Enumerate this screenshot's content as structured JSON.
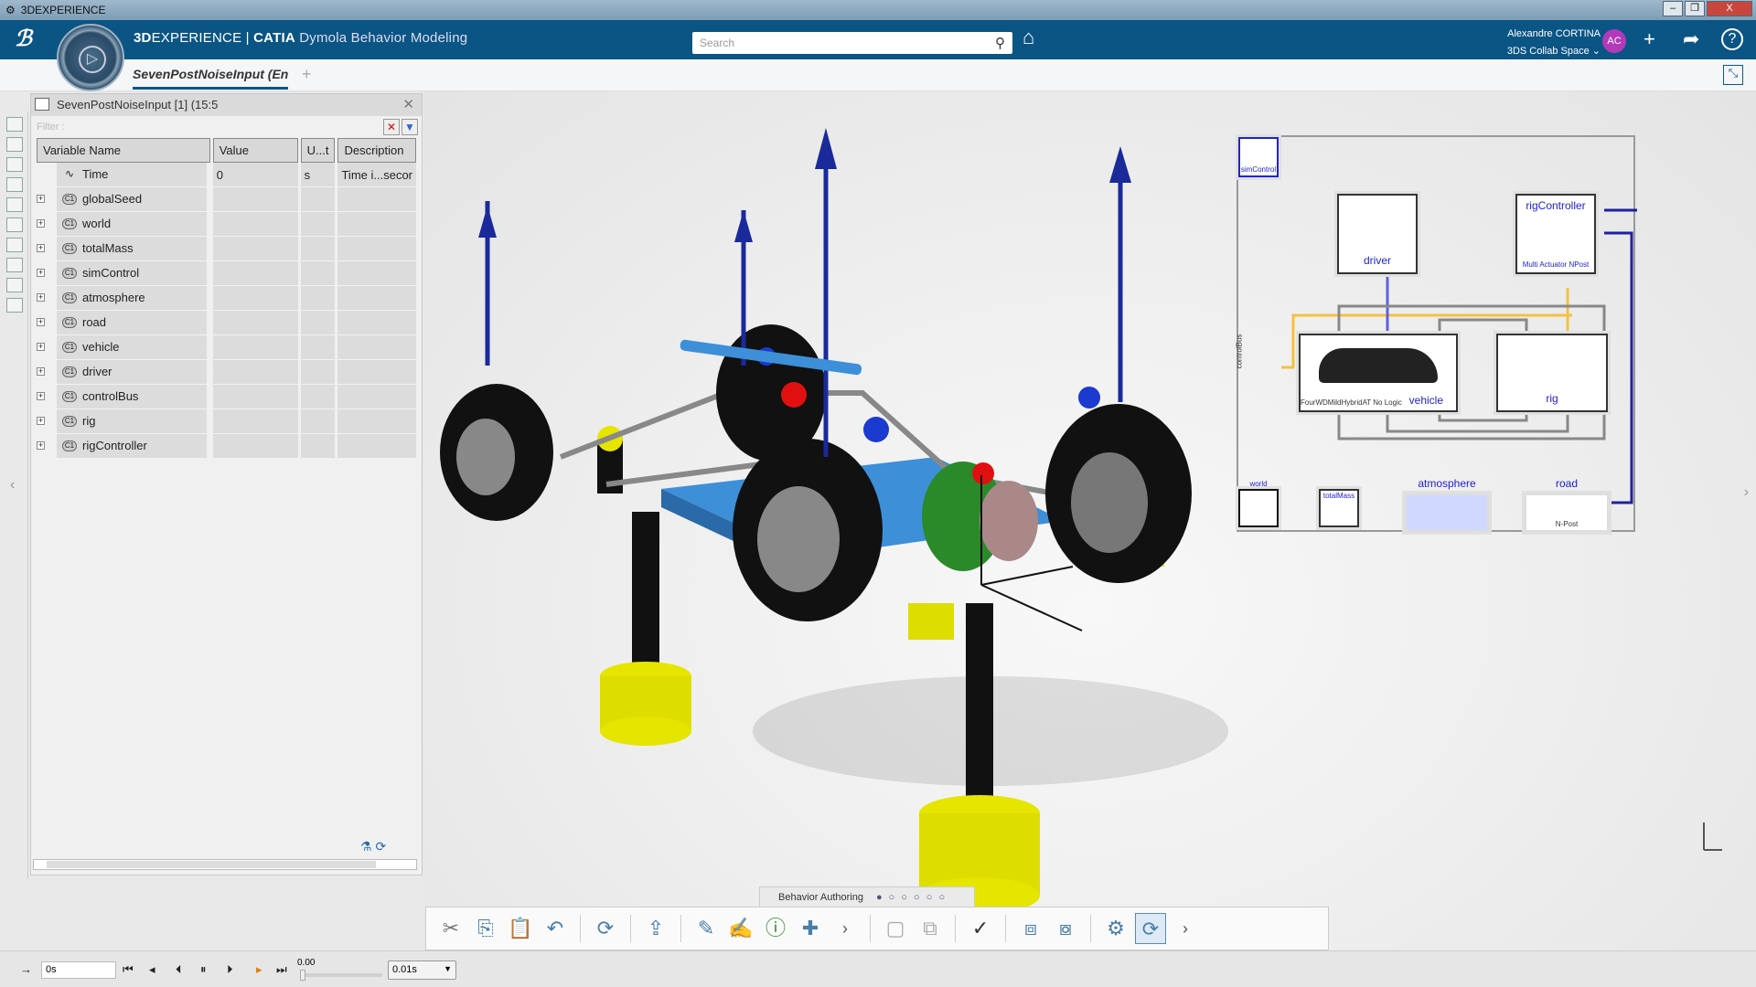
{
  "window": {
    "title": "3DEXPERIENCE",
    "minimize": "–",
    "restore": "❐",
    "close": "X"
  },
  "header": {
    "brand_3d": "3D",
    "brand_exp": "EXPERIENCE",
    "brand_sep": "|",
    "brand_catia": "CATIA",
    "app_name": "Dymola Behavior Modeling",
    "search_placeholder": "Search",
    "user_name": "Alexandre CORTINA",
    "collab_space": "3DS Collab Space",
    "avatar_initials": "AC",
    "compass_play": "▷"
  },
  "tabs": [
    {
      "label": "SevenPostNoiseInput (Encr",
      "active": true
    }
  ],
  "add_tab": "+",
  "panel": {
    "title": "SevenPostNoiseInput [1] (15:5",
    "filter_label": "Filter :",
    "columns": [
      "Variable Name",
      "Value",
      "U...t",
      "Description"
    ],
    "rows": [
      {
        "name": "Time",
        "value": "0",
        "unit": "s",
        "description": "Time i...secor"
      },
      {
        "name": "globalSeed"
      },
      {
        "name": "world"
      },
      {
        "name": "totalMass"
      },
      {
        "name": "simControl"
      },
      {
        "name": "atmosphere"
      },
      {
        "name": "road"
      },
      {
        "name": "vehicle"
      },
      {
        "name": "driver"
      },
      {
        "name": "controlBus"
      },
      {
        "name": "rig"
      },
      {
        "name": "rigController"
      }
    ]
  },
  "diagram": {
    "blocks": {
      "simControl": "simControl",
      "driver": "driver",
      "rigController": "rigController",
      "rigController_sub": "Multi Actuator NPost",
      "vehicle": "vehicle",
      "vehicle_sub": "FourWDMildHybridAT No Logic",
      "rig": "rig",
      "world": "world",
      "totalMass": "totalMass",
      "atmosphere": "atmosphere",
      "road": "road",
      "road_sub": "N-Post",
      "controlBus": "controlBus"
    }
  },
  "toolbar": {
    "section_label": "Behavior Authoring",
    "section_dots": "● ○ ○ ○ ○ ○ ○"
  },
  "playback": {
    "time_value": "0s",
    "slider_value": "0.00",
    "step": "0.01s",
    "progress": 0
  }
}
